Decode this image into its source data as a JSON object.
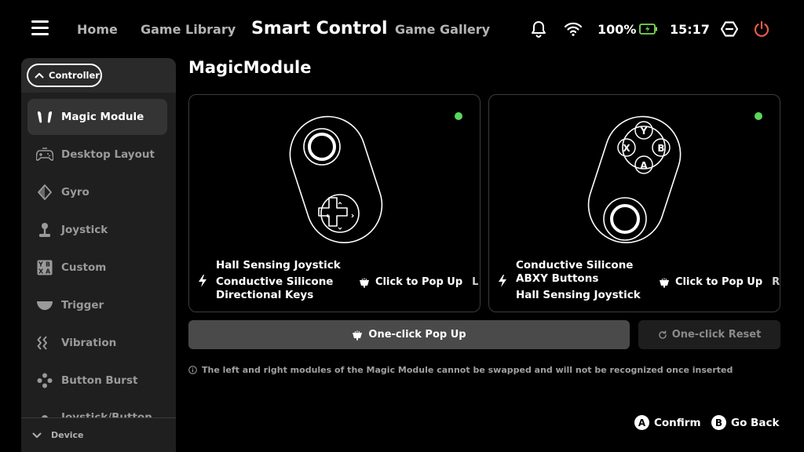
{
  "nav": {
    "tabs": [
      "Home",
      "Game Library",
      "Smart Control",
      "Game Gallery"
    ],
    "active_tab": "Smart Control"
  },
  "status": {
    "battery": "100%",
    "time": "15:17",
    "icons": [
      "bell-icon",
      "wifi-icon",
      "battery-icon",
      "settings-hex-icon",
      "power-icon"
    ],
    "accent_power": "#e85a4f",
    "battery_color": "#7ed957"
  },
  "sidebar": {
    "section": "Controller",
    "items": [
      {
        "label": "Magic Module",
        "icon": "magic-module-icon",
        "active": true
      },
      {
        "label": "Desktop Layout",
        "icon": "gamepad-icon"
      },
      {
        "label": "Gyro",
        "icon": "gyro-icon"
      },
      {
        "label": "Joystick",
        "icon": "joystick-icon"
      },
      {
        "label": "Custom",
        "icon": "xyba-icon"
      },
      {
        "label": "Trigger",
        "icon": "trigger-icon"
      },
      {
        "label": "Vibration",
        "icon": "vibration-icon"
      },
      {
        "label": "Button Burst",
        "icon": "button-burst-icon"
      },
      {
        "label": "Joystick/Button",
        "icon": "joystick-button-icon"
      }
    ],
    "footer": "Device"
  },
  "main": {
    "title": "MagicModule",
    "status_color": "#5cd65c",
    "left_module": {
      "features": [
        "Hall Sensing Joystick",
        "Conductive Silicone",
        "Directional Keys"
      ],
      "popup_label": "Click to Pop Up",
      "side": "L"
    },
    "right_module": {
      "features": [
        "Conductive Silicone",
        "ABXY Buttons",
        "Hall Sensing Joystick"
      ],
      "popup_label": "Click to Pop Up",
      "side": "R",
      "buttons": [
        "Y",
        "X",
        "B",
        "A"
      ]
    },
    "popup_all_label": "One-click Pop Up",
    "reset_label": "One-click Reset",
    "notice": "The left and right modules of the Magic Module cannot be swapped and will not be recognized once inserted"
  },
  "hints": {
    "confirm_key": "A",
    "confirm_label": "Confirm",
    "back_key": "B",
    "back_label": "Go Back"
  }
}
